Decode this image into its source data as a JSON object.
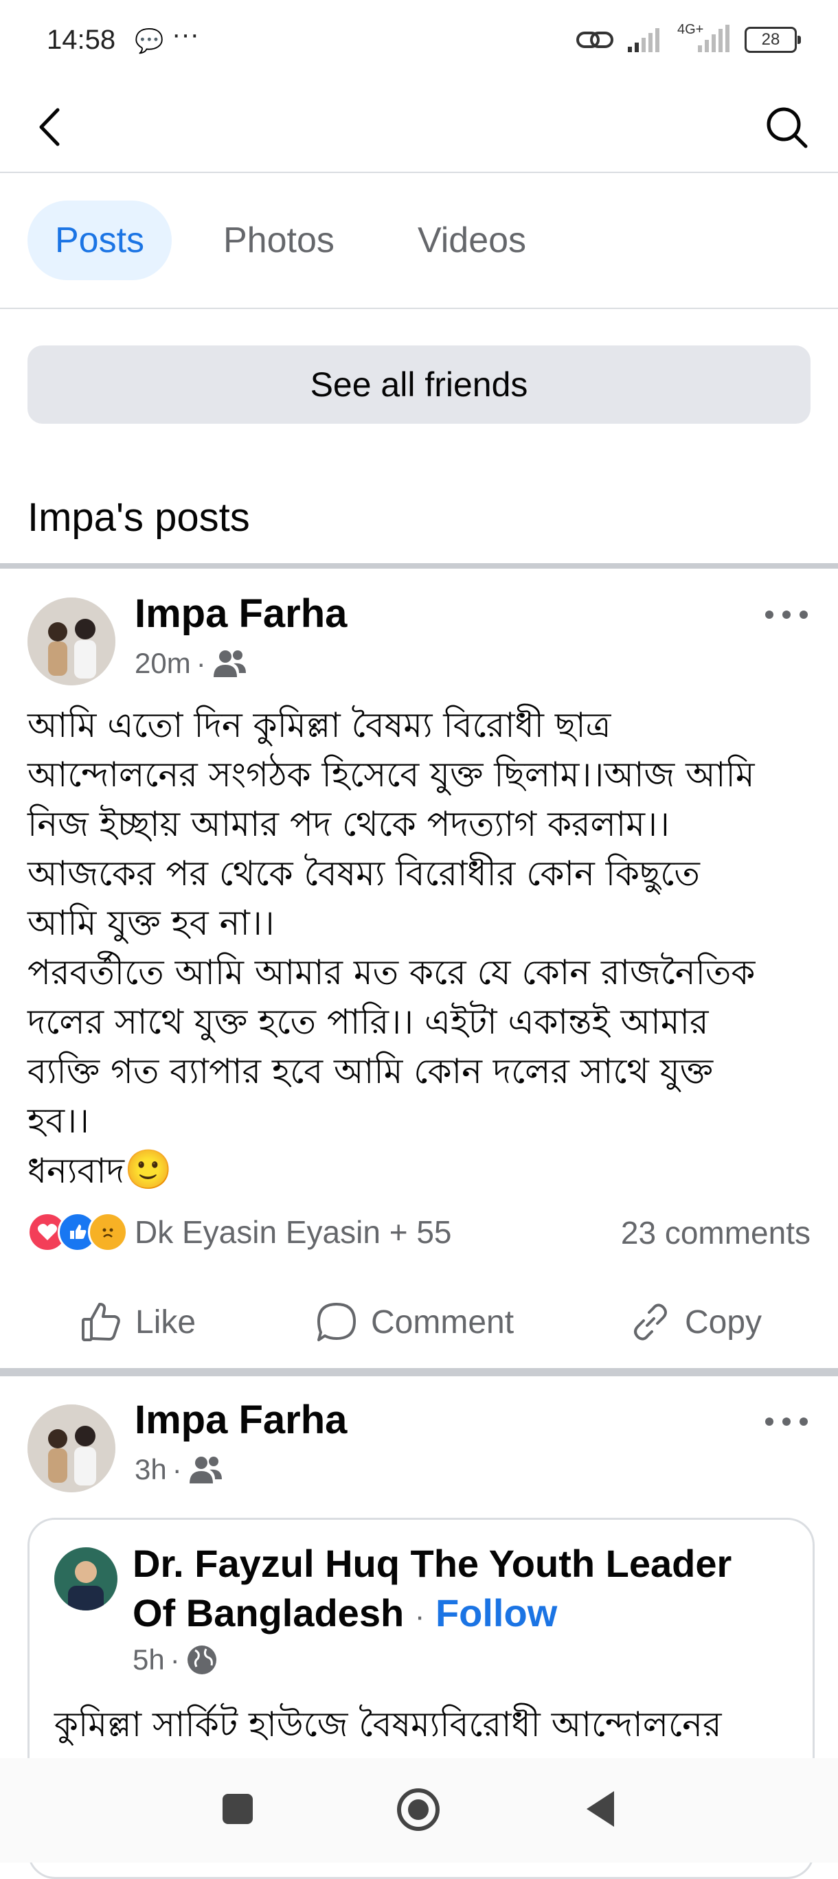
{
  "status_bar": {
    "time": "14:58",
    "battery": "28",
    "network": "4G+"
  },
  "tabs": [
    {
      "label": "Posts",
      "active": true
    },
    {
      "label": "Photos",
      "active": false
    },
    {
      "label": "Videos",
      "active": false
    }
  ],
  "see_all_friends": "See all friends",
  "section_title": "Impa's posts",
  "post1": {
    "author": "Impa Farha",
    "time": "20m",
    "audience_icon": "friends-icon",
    "text": "আমি এতো দিন কুমিল্লা বৈষম্য বিরোধী ছাত্র\nআন্দোলনের সংগঠক  হিসেবে যুক্ত ছিলাম।।আজ আমি\nনিজ ইচ্ছায় আমার পদ থেকে পদত্যাগ করলাম।।\nআজকের পর থেকে বৈষম্য বিরোধীর কোন কিছুতে\nআমি যুক্ত হব না।।\nপরবর্তীতে আমি আমার মত করে যে কোন রাজনৈতিক\nদলের সাথে যুক্ত হতে পারি।। এইটা একান্তই আমার\nব্যক্তি গত ব্যাপার হবে আমি কোন দলের সাথে যুক্ত\nহব।।\nধন্যবাদ",
    "emoji": "🙂",
    "reactions_text": "Dk Eyasin Eyasin + 55",
    "comments": "23 comments",
    "actions": {
      "like": "Like",
      "comment": "Comment",
      "copy": "Copy"
    }
  },
  "post2": {
    "author": "Impa Farha",
    "time": "3h",
    "shared": {
      "author_line1": "Dr. Fayzul Huq The Youth Leader",
      "author_line2": "Of Bangladesh",
      "follow": "Follow",
      "time": "5h",
      "text": "কুমিল্লা সার্কিট হাউজে বৈষম্যবিরোধী আন্দোলনের"
    }
  },
  "colors": {
    "accent": "#1b74e4",
    "tab_active_bg": "#e7f3ff",
    "button_bg": "#e4e6eb",
    "secondary_text": "#65676b"
  }
}
